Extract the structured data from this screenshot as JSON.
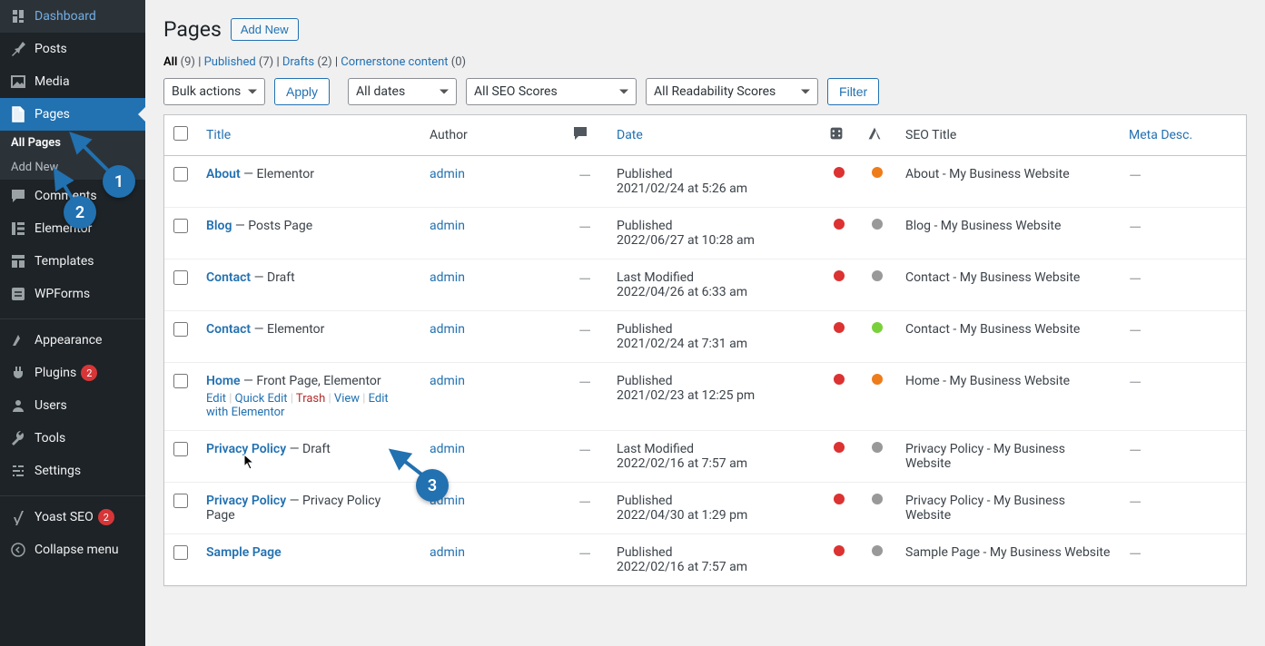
{
  "sidebar": {
    "items": [
      {
        "icon": "dashboard",
        "label": "Dashboard"
      },
      {
        "icon": "pin",
        "label": "Posts"
      },
      {
        "icon": "media",
        "label": "Media"
      },
      {
        "icon": "page",
        "label": "Pages",
        "active": true
      },
      {
        "icon": "comment",
        "label": "Comments"
      },
      {
        "icon": "elementor",
        "label": "Elementor"
      },
      {
        "icon": "templates",
        "label": "Templates"
      },
      {
        "icon": "wpforms",
        "label": "WPForms"
      },
      {
        "icon": "appearance",
        "label": "Appearance"
      },
      {
        "icon": "plugin",
        "label": "Plugins",
        "badge": "2"
      },
      {
        "icon": "users",
        "label": "Users"
      },
      {
        "icon": "tools",
        "label": "Tools"
      },
      {
        "icon": "settings",
        "label": "Settings"
      },
      {
        "icon": "yoast",
        "label": "Yoast SEO",
        "badge": "2"
      },
      {
        "icon": "collapse",
        "label": "Collapse menu"
      }
    ],
    "submenu": [
      {
        "label": "All Pages",
        "current": true
      },
      {
        "label": "Add New"
      }
    ]
  },
  "page": {
    "title": "Pages",
    "add_new": "Add New"
  },
  "filters": {
    "all_label": "All",
    "all_count": "(9)",
    "published_label": "Published",
    "published_count": "(7)",
    "drafts_label": "Drafts",
    "drafts_count": "(2)",
    "cornerstone_label": "Cornerstone content",
    "cornerstone_count": "(0)"
  },
  "toolbar": {
    "bulk_actions": "Bulk actions",
    "apply": "Apply",
    "all_dates": "All dates",
    "seo_scores": "All SEO Scores",
    "readability_scores": "All Readability Scores",
    "filter": "Filter"
  },
  "columns": {
    "title": "Title",
    "author": "Author",
    "date": "Date",
    "seo": "SEO Title",
    "meta": "Meta Desc."
  },
  "row_actions": {
    "edit": "Edit",
    "quick_edit": "Quick Edit",
    "trash": "Trash",
    "view": "View",
    "edit_elementor": "Edit with Elementor"
  },
  "rows": [
    {
      "title": "About",
      "suffix": " — Elementor",
      "author": "admin",
      "status": "Published",
      "date": "2021/02/24 at 5:26 am",
      "dot1": "red",
      "dot2": "orange",
      "seo": "About - My Business Website"
    },
    {
      "title": "Blog",
      "suffix": " — Posts Page",
      "author": "admin",
      "status": "Published",
      "date": "2022/06/27 at 10:28 am",
      "dot1": "red",
      "dot2": "gray",
      "seo": "Blog - My Business Website"
    },
    {
      "title": "Contact",
      "suffix": " — Draft",
      "author": "admin",
      "status": "Last Modified",
      "date": "2022/04/26 at 6:33 am",
      "dot1": "red",
      "dot2": "gray",
      "seo": "Contact - My Business Website"
    },
    {
      "title": "Contact",
      "suffix": " — Elementor",
      "author": "admin",
      "status": "Published",
      "date": "2021/02/24 at 7:31 am",
      "dot1": "red",
      "dot2": "green",
      "seo": "Contact - My Business Website"
    },
    {
      "title": "Home",
      "suffix": " — Front Page, Elementor",
      "author": "admin",
      "status": "Published",
      "date": "2021/02/23 at 12:25 pm",
      "dot1": "red",
      "dot2": "orange",
      "seo": "Home - My Business Website",
      "hover": true
    },
    {
      "title": "Privacy Policy",
      "suffix": " — Draft",
      "author": "admin",
      "status": "Last Modified",
      "date": "2022/02/16 at 7:57 am",
      "dot1": "red",
      "dot2": "gray",
      "seo": "Privacy Policy - My Business Website"
    },
    {
      "title": "Privacy Policy",
      "suffix": " — Privacy Policy Page",
      "author": "admin",
      "status": "Published",
      "date": "2022/04/30 at 1:29 pm",
      "dot1": "red",
      "dot2": "gray",
      "seo": "Privacy Policy - My Business Website"
    },
    {
      "title": "Sample Page",
      "suffix": "",
      "author": "admin",
      "status": "Published",
      "date": "2022/02/16 at 7:57 am",
      "dot1": "red",
      "dot2": "gray",
      "seo": "Sample Page - My Business Website"
    }
  ],
  "annotations": {
    "one": "1",
    "two": "2",
    "three": "3"
  }
}
